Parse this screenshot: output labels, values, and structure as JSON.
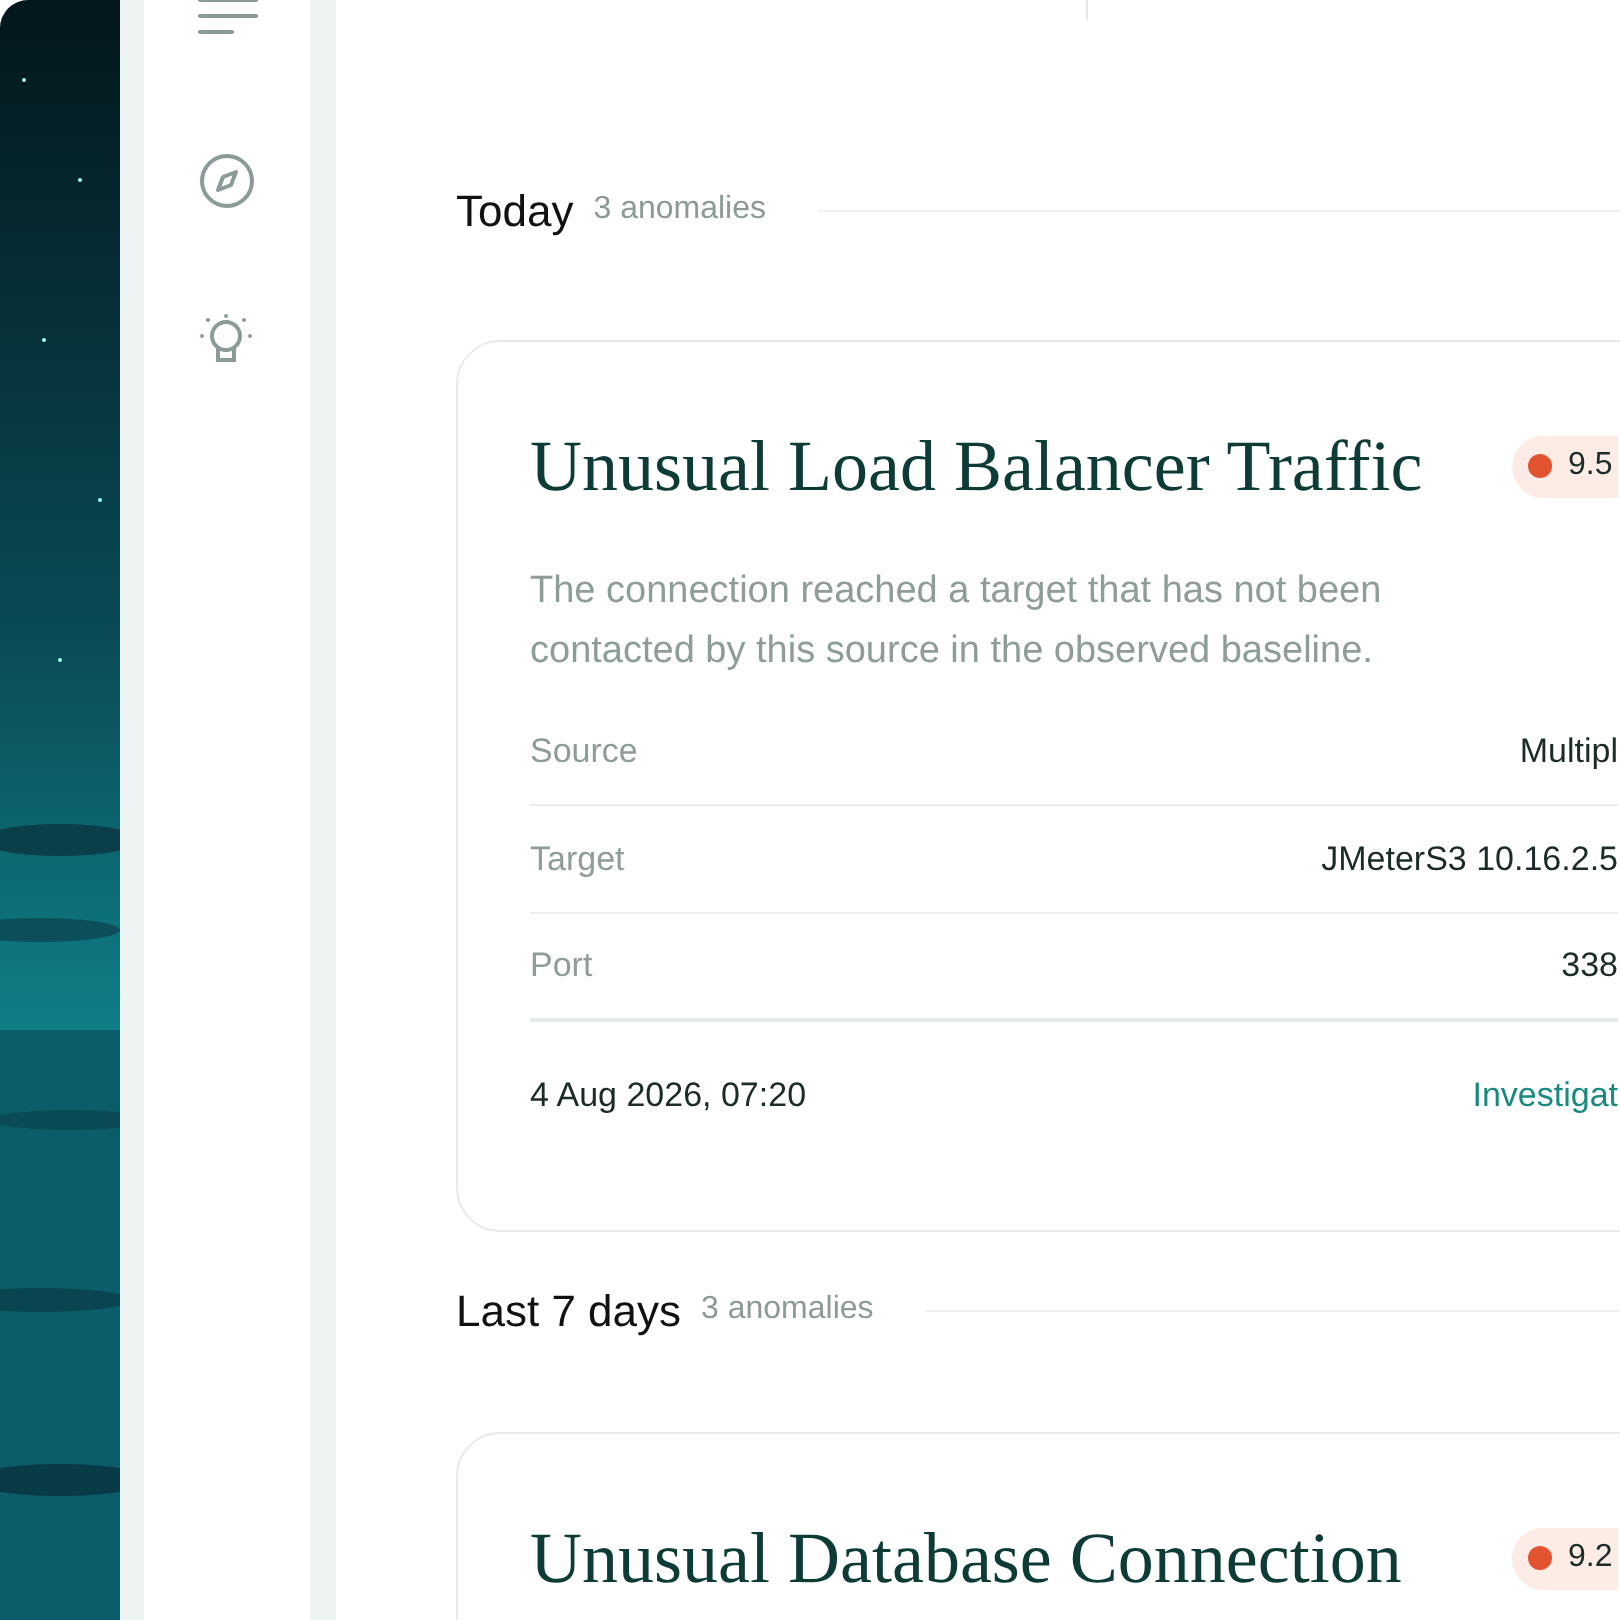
{
  "sections": [
    {
      "title": "Today",
      "count": "3 anomalies",
      "cards": [
        {
          "title": "Unusual Load Balancer Traffic",
          "score": "9.5",
          "color": "#e4532f",
          "description": "The connection reached a target that has not been contacted by this source in the observed baseline.",
          "fields": [
            {
              "label": "Source",
              "value": "Multipl"
            },
            {
              "label": "Target",
              "value": "JMeterS3 10.16.2.5"
            },
            {
              "label": "Port",
              "value": "338"
            }
          ],
          "time": "4 Aug 2026, 07:20",
          "action": "Investigat"
        }
      ]
    },
    {
      "title": "Last 7 days",
      "count": "3 anomalies",
      "cards": [
        {
          "title": "Unusual Database Connection",
          "score": "9.2",
          "color": "#e4532f"
        }
      ]
    }
  ]
}
